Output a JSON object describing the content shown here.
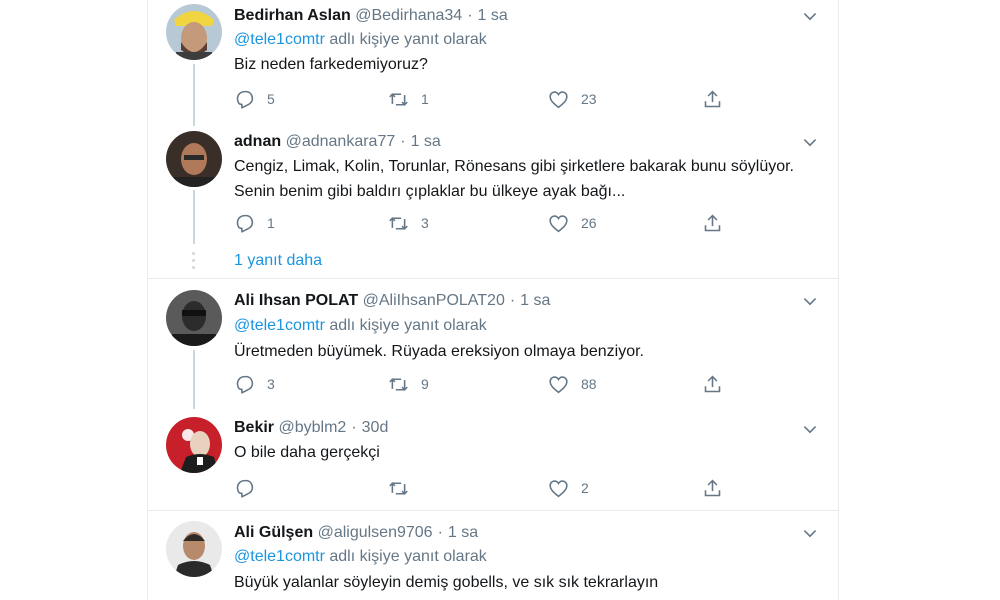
{
  "tweets": [
    {
      "name": "Bedirhan Aslan",
      "handle": "@Bedirhana34",
      "time": "1 sa",
      "reply_prefix": "@tele1comtr",
      "reply_suffix": " adlı kişiye yanıt olarak",
      "text": "Biz neden farkedemiyoruz?",
      "replies": "5",
      "retweets": "1",
      "likes": "23"
    },
    {
      "name": "adnan",
      "handle": "@adnankara77",
      "time": "1 sa",
      "text": "Cengiz, Limak, Kolin, Torunlar, Rönesans gibi şirketlere bakarak bunu söylüyor. Senin benim gibi baldırı çıplaklar bu ülkeye ayak bağı...",
      "replies": "1",
      "retweets": "3",
      "likes": "26"
    },
    {
      "name": "Ali Ihsan POLAT",
      "handle": "@AliIhsanPOLAT20",
      "time": "1 sa",
      "reply_prefix": "@tele1comtr",
      "reply_suffix": " adlı kişiye yanıt olarak",
      "text": "Üretmeden büyümek. Rüyada ereksiyon olmaya benziyor.",
      "replies": "3",
      "retweets": "9",
      "likes": "88"
    },
    {
      "name": "Bekir",
      "handle": "@byblm2",
      "time": "30d",
      "text": "O bile daha gerçekçi",
      "replies": "",
      "retweets": "",
      "likes": "2"
    },
    {
      "name": "Ali Gülşen",
      "handle": "@aligulsen9706",
      "time": "1 sa",
      "reply_prefix": "@tele1comtr",
      "reply_suffix": " adlı kişiye yanıt olarak",
      "text": "Büyük yalanlar söyleyin demiş gobells, ve sık sık tekrarlayın"
    }
  ],
  "more_replies_label": "1 yanıt daha",
  "separator": "·",
  "icons": {
    "reply": "reply-icon",
    "retweet": "retweet-icon",
    "like": "like-icon",
    "share": "share-icon",
    "chevron": "chevron-down-icon"
  },
  "colors": {
    "link": "#1b95e0",
    "muted": "#657786",
    "text": "#14171a",
    "border": "#e6ecf0"
  }
}
